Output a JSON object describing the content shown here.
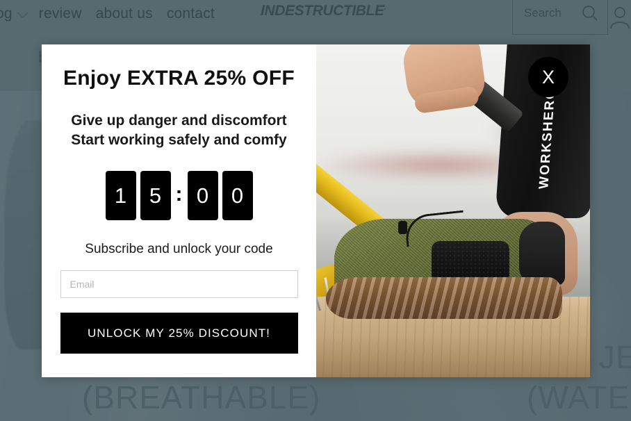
{
  "header": {
    "nav_primary": [
      {
        "label": "og",
        "has_chevron": true
      },
      {
        "label": "review",
        "has_chevron": false
      },
      {
        "label": "about us",
        "has_chevron": false
      },
      {
        "label": "contact",
        "has_chevron": false
      }
    ],
    "brand": "INDESTRUCTIBLE",
    "brand_tm": ".",
    "search": {
      "placeholder": "Search",
      "value": "",
      "icon": "search-icon"
    },
    "account_icon": "user-account-icon",
    "nav_secondary": [
      {
        "label": "b"
      }
    ]
  },
  "background": {
    "hero_words": [
      "(BREATHABLE)",
      "JE",
      "(WATER"
    ]
  },
  "popup": {
    "heading": "Enjoy  EXTRA 25% OFF",
    "subheading_line1": "Give up danger and discomfort",
    "subheading_line2": "Start working safely and comfy",
    "countdown": {
      "minutes": [
        "1",
        "5"
      ],
      "separator": ":",
      "seconds": [
        "0",
        "0"
      ],
      "display": "15:00"
    },
    "subscribe_label": "Subscribe and unlock your code",
    "email": {
      "placeholder": "Email",
      "value": ""
    },
    "cta_label": "UNLOCK  MY 25%  DISCOUNT!",
    "close_label": "X",
    "image": {
      "alt": "Work boot stepping on nails while a yellow hammer strikes the toe cap",
      "pants_text": "WORKSHEROW"
    }
  },
  "colors": {
    "overlay": "#566a70",
    "overlay_text": "#3a4b52",
    "popup_bg": "#ffffff",
    "accent_black": "#000000",
    "cta_text": "#ffffff",
    "hero_word": "#4e6067",
    "input_border": "#cfcfcf"
  }
}
